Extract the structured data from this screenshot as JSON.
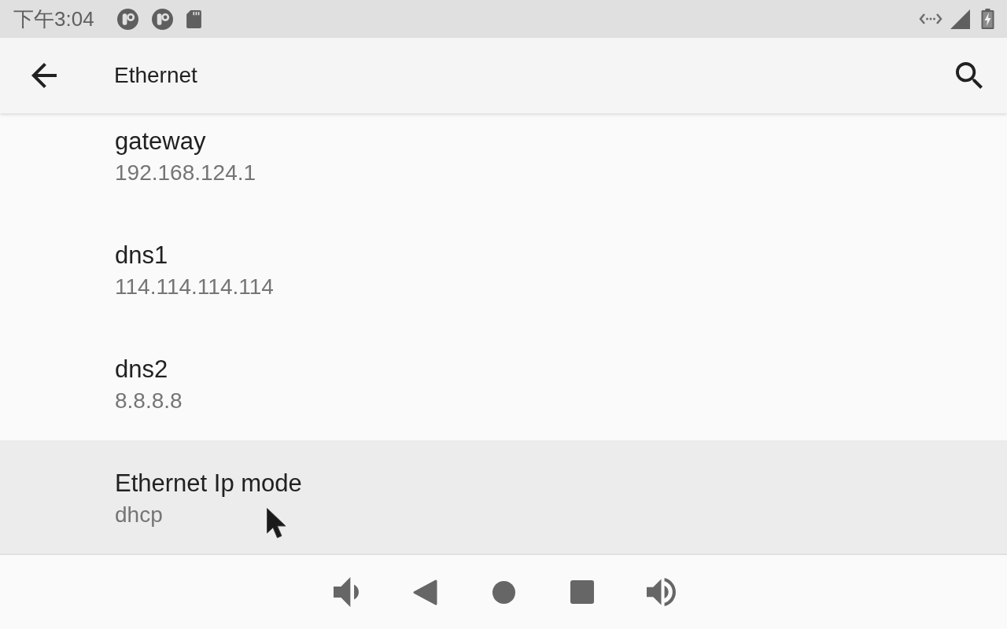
{
  "status_bar": {
    "time": "下午3:04"
  },
  "app_bar": {
    "title": "Ethernet"
  },
  "preferences": [
    {
      "title": "gateway",
      "value": "192.168.124.1",
      "selected": false
    },
    {
      "title": "dns1",
      "value": "114.114.114.114",
      "selected": false
    },
    {
      "title": "dns2",
      "value": "8.8.8.8",
      "selected": false
    },
    {
      "title": "Ethernet Ip mode",
      "value": "dhcp",
      "selected": true
    }
  ]
}
